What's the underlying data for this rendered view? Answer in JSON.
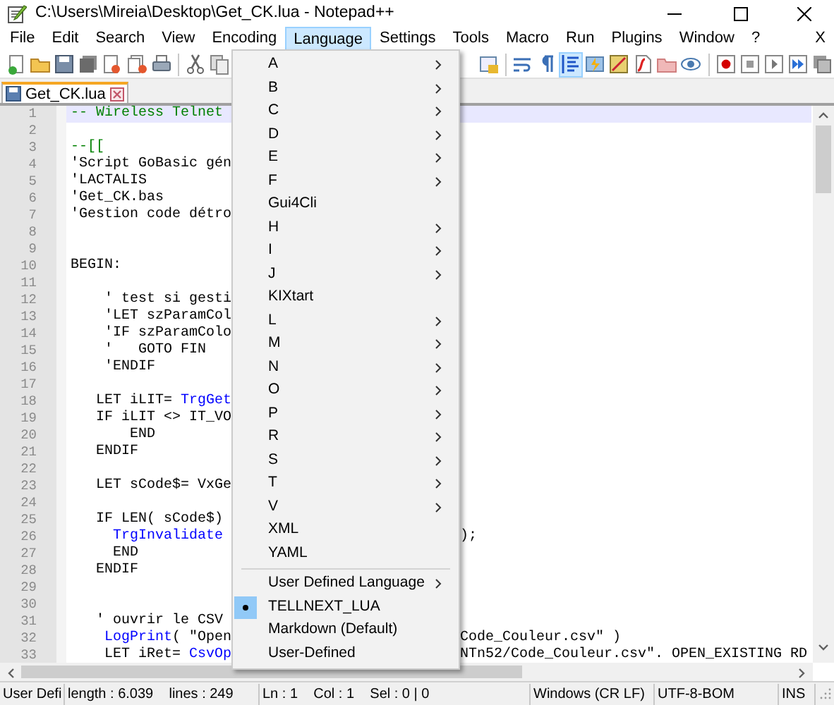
{
  "window": {
    "title": "C:\\Users\\Mireia\\Desktop\\Get_CK.lua - Notepad++"
  },
  "menu_bar": [
    {
      "label": "File",
      "selected": false
    },
    {
      "label": "Edit",
      "selected": false
    },
    {
      "label": "Search",
      "selected": false
    },
    {
      "label": "View",
      "selected": false
    },
    {
      "label": "Encoding",
      "selected": false
    },
    {
      "label": "Language",
      "selected": true
    },
    {
      "label": "Settings",
      "selected": false
    },
    {
      "label": "Tools",
      "selected": false
    },
    {
      "label": "Macro",
      "selected": false
    },
    {
      "label": "Run",
      "selected": false
    },
    {
      "label": "Plugins",
      "selected": false
    },
    {
      "label": "Window",
      "selected": false
    },
    {
      "label": "?",
      "selected": false
    }
  ],
  "close_document": "X",
  "toolbar": [
    {
      "pressed": false
    },
    {
      "pressed": false
    },
    {
      "pressed": false
    },
    {
      "pressed": false
    },
    {
      "pressed": false
    },
    {
      "pressed": false
    },
    {
      "pressed": false
    },
    {
      "pressed": false
    },
    {
      "pressed": false
    },
    {
      "pressed": false
    },
    {
      "pressed": false
    },
    {
      "pressed": false
    },
    {
      "pressed": true
    },
    {
      "pressed": false
    },
    {
      "pressed": false
    },
    {
      "pressed": false
    },
    {
      "pressed": false
    },
    {
      "pressed": false
    },
    {
      "pressed": false
    },
    {
      "pressed": false
    },
    {
      "pressed": false
    },
    {
      "pressed": false
    },
    {
      "pressed": false
    }
  ],
  "tabs": [
    {
      "label": "Get_CK.lua",
      "selected": true
    }
  ],
  "editor": {
    "lines": [
      {
        "number": "1",
        "current": true,
        "segments": [
          {
            "text": "-- Wireless Telnet",
            "kind": "comment"
          }
        ]
      },
      {
        "number": "2",
        "current": false
      },
      {
        "number": "3",
        "current": false,
        "segments": [
          {
            "text": "--[[",
            "kind": "comment"
          }
        ]
      },
      {
        "number": "4",
        "current": false,
        "segments": [
          {
            "text": "'Script GoBasic gén",
            "kind": "plain"
          }
        ]
      },
      {
        "number": "5",
        "current": false,
        "segments": [
          {
            "text": "'LACTALIS",
            "kind": "plain"
          }
        ]
      },
      {
        "number": "6",
        "current": false,
        "segments": [
          {
            "text": "'Get_CK.bas",
            "kind": "plain"
          }
        ]
      },
      {
        "number": "7",
        "current": false,
        "segments": [
          {
            "text": "'Gestion code détro",
            "kind": "plain"
          }
        ]
      },
      {
        "number": "8",
        "current": false
      },
      {
        "number": "9",
        "current": false
      },
      {
        "number": "10",
        "current": false,
        "segments": [
          {
            "text": "BEGIN:",
            "kind": "plain"
          }
        ]
      },
      {
        "number": "11",
        "current": false
      },
      {
        "number": "12",
        "current": false,
        "segments": [
          {
            "text": "    ' test si gesti",
            "kind": "plain"
          }
        ]
      },
      {
        "number": "13",
        "current": false,
        "segments": [
          {
            "text": "    'LET szParamCol",
            "kind": "plain"
          }
        ]
      },
      {
        "number": "14",
        "current": false,
        "segments": [
          {
            "text": "    'IF szParamColo",
            "kind": "plain"
          }
        ]
      },
      {
        "number": "15",
        "current": false,
        "segments": [
          {
            "text": "    '   GOTO FIN",
            "kind": "plain"
          }
        ]
      },
      {
        "number": "16",
        "current": false,
        "segments": [
          {
            "text": "    'ENDIF",
            "kind": "plain"
          }
        ]
      },
      {
        "number": "17",
        "current": false
      },
      {
        "number": "18",
        "current": false,
        "segments": [
          {
            "text": "   LET iLIT= ",
            "kind": "plain"
          },
          {
            "text": "TrgGet",
            "kind": "function"
          }
        ]
      },
      {
        "number": "19",
        "current": false,
        "segments": [
          {
            "text": "   IF iLIT <> IT_VO",
            "kind": "plain"
          }
        ]
      },
      {
        "number": "20",
        "current": false,
        "segments": [
          {
            "text": "       END",
            "kind": "plain"
          }
        ]
      },
      {
        "number": "21",
        "current": false,
        "segments": [
          {
            "text": "   ENDIF",
            "kind": "plain"
          }
        ]
      },
      {
        "number": "22",
        "current": false
      },
      {
        "number": "23",
        "current": false,
        "segments": [
          {
            "text": "   LET sCode$= VxGe",
            "kind": "plain"
          }
        ]
      },
      {
        "number": "24",
        "current": false
      },
      {
        "number": "25",
        "current": false,
        "segments": [
          {
            "text": "   IF LEN( sCode$)",
            "kind": "plain"
          }
        ]
      },
      {
        "number": "26",
        "current": false,
        "segments": [
          {
            "text": "     TrgInvalidate",
            "kind": "function"
          }
        ],
        "tail": ");"
      },
      {
        "number": "27",
        "current": false,
        "segments": [
          {
            "text": "     END",
            "kind": "plain"
          }
        ]
      },
      {
        "number": "28",
        "current": false,
        "segments": [
          {
            "text": "   ENDIF",
            "kind": "plain"
          }
        ]
      },
      {
        "number": "29",
        "current": false
      },
      {
        "number": "30",
        "current": false
      },
      {
        "number": "31",
        "current": false,
        "segments": [
          {
            "text": "   ' ouvrir le CSV",
            "kind": "plain"
          }
        ]
      },
      {
        "number": "32",
        "current": false,
        "segments": [
          {
            "text": "    LogPrint",
            "kind": "function"
          },
          {
            "text": "( \"Open",
            "kind": "plain"
          }
        ],
        "tail": "Code_Couleur.csv\" )"
      },
      {
        "number": "33",
        "current": false,
        "segments": [
          {
            "text": "    LET iRet= ",
            "kind": "plain"
          },
          {
            "text": "CsvOp",
            "kind": "function"
          }
        ],
        "tail": "NTn52/Code_Couleur.csv\". OPEN_EXISTING RD"
      }
    ]
  },
  "language_menu": [
    {
      "kind": "item",
      "label": "A",
      "submenu": true,
      "selected": false
    },
    {
      "kind": "item",
      "label": "B",
      "submenu": true,
      "selected": false
    },
    {
      "kind": "item",
      "label": "C",
      "submenu": true,
      "selected": false
    },
    {
      "kind": "item",
      "label": "D",
      "submenu": true,
      "selected": false
    },
    {
      "kind": "item",
      "label": "E",
      "submenu": true,
      "selected": false
    },
    {
      "kind": "item",
      "label": "F",
      "submenu": true,
      "selected": false
    },
    {
      "kind": "item",
      "label": "Gui4Cli",
      "submenu": false,
      "selected": false
    },
    {
      "kind": "item",
      "label": "H",
      "submenu": true,
      "selected": false
    },
    {
      "kind": "item",
      "label": "I",
      "submenu": true,
      "selected": false
    },
    {
      "kind": "item",
      "label": "J",
      "submenu": true,
      "selected": false
    },
    {
      "kind": "item",
      "label": "KIXtart",
      "submenu": false,
      "selected": false
    },
    {
      "kind": "item",
      "label": "L",
      "submenu": true,
      "selected": false
    },
    {
      "kind": "item",
      "label": "M",
      "submenu": true,
      "selected": false
    },
    {
      "kind": "item",
      "label": "N",
      "submenu": true,
      "selected": false
    },
    {
      "kind": "item",
      "label": "O",
      "submenu": true,
      "selected": false
    },
    {
      "kind": "item",
      "label": "P",
      "submenu": true,
      "selected": false
    },
    {
      "kind": "item",
      "label": "R",
      "submenu": true,
      "selected": false
    },
    {
      "kind": "item",
      "label": "S",
      "submenu": true,
      "selected": false
    },
    {
      "kind": "item",
      "label": "T",
      "submenu": true,
      "selected": false
    },
    {
      "kind": "item",
      "label": "V",
      "submenu": true,
      "selected": false
    },
    {
      "kind": "item",
      "label": "XML",
      "submenu": false,
      "selected": false
    },
    {
      "kind": "item",
      "label": "YAML",
      "submenu": false,
      "selected": false
    },
    {
      "kind": "separator"
    },
    {
      "kind": "item",
      "label": "User Defined Language",
      "submenu": true,
      "selected": false
    },
    {
      "kind": "item",
      "label": "TELLNEXT_LUA",
      "submenu": false,
      "selected": true
    },
    {
      "kind": "item",
      "label": "Markdown (Default)",
      "submenu": false,
      "selected": false
    },
    {
      "kind": "item",
      "label": "User-Defined",
      "submenu": false,
      "selected": false
    }
  ],
  "status_bar": [
    "User Defi",
    "length : 6.039    lines : 249",
    "Ln : 1    Col : 1    Sel : 0 | 0",
    "Windows (CR LF)",
    "UTF-8-BOM",
    "INS"
  ]
}
